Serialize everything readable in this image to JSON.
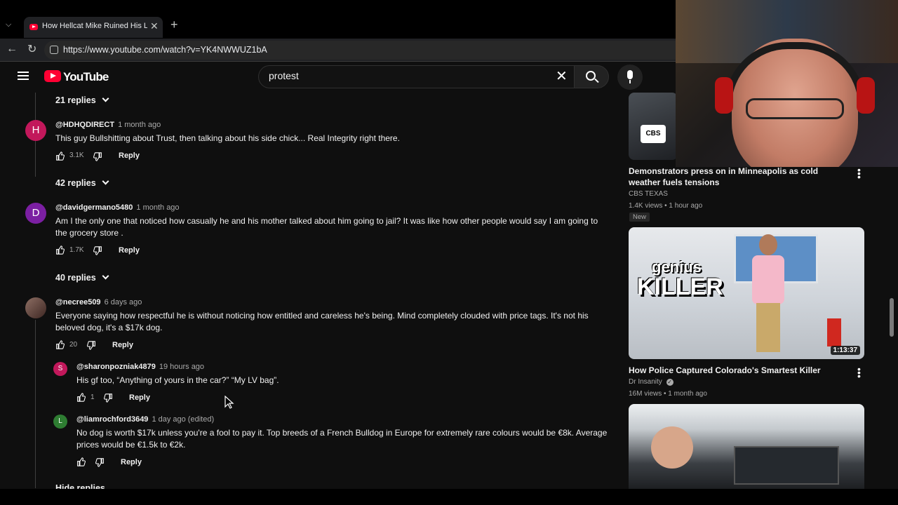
{
  "browser": {
    "tab_title": "How Hellcat Mike Ruined His Life",
    "url": "https://www.youtube.com/watch?v=YK4NWWUZ1bA"
  },
  "youtube": {
    "logo_text": "YouTube",
    "search_value": "protest"
  },
  "comments": {
    "replies_0": "21 replies",
    "c1": {
      "avatar": "H",
      "avatar_color": "#c2185b",
      "author": "@HDHQDIRECT",
      "time": "1 month ago",
      "text": "This guy Bullshitting about Trust, then talking about his side chick... Real Integrity right there.",
      "likes": "3.1K",
      "reply": "Reply"
    },
    "replies_1": "42 replies",
    "c2": {
      "avatar": "D",
      "avatar_color": "#7b1fa2",
      "author": "@davidgermano5480",
      "time": "1 month ago",
      "text": "Am I the only one that noticed how casually he and his mother talked about him going to jail?  It was like how other people would say I am going to the grocery store .",
      "likes": "1.7K",
      "reply": "Reply"
    },
    "replies_2": "40 replies",
    "c3": {
      "author": "@necree509",
      "time": "6 days ago",
      "text": "Everyone saying how respectful he is without noticing how entitled and careless he's being. Mind completely clouded with price tags. It's not his beloved dog, it's a $17k dog.",
      "likes": "20",
      "reply": "Reply"
    },
    "r1": {
      "avatar": "S",
      "avatar_color": "#c2185b",
      "author": "@sharonpozniak4879",
      "time": "19 hours ago",
      "text": "His gf too, “Anything of yours in the car?” “My LV bag”.",
      "likes": "1",
      "reply": "Reply"
    },
    "r2": {
      "avatar": "L",
      "avatar_color": "#2e7d32",
      "author": "@liamrochford3649",
      "time": "1 day ago (edited)",
      "text": "No dog is worth $17k unless you're a fool to pay it. Top breeds of a French Bulldog in Europe for extremely rare colours would be €8k. Average prices would be €1.5k to €2k.",
      "reply": "Reply"
    },
    "hide_replies": "Hide replies"
  },
  "sidebar": {
    "v1": {
      "title": "Demonstrators press on in Minneapolis as cold weather fuels tensions",
      "channel": "CBS TEXAS",
      "meta": "1.4K views • 1 hour ago",
      "badge": "New",
      "thumb_logo": "CBS"
    },
    "v2": {
      "title": "How Police Captured Colorado's Smartest Killer",
      "channel": "Dr Insanity",
      "meta": "16M views • 1 month ago",
      "duration": "1:13:37",
      "thumb_text_1": "genius",
      "thumb_text_2": "KILLER"
    }
  }
}
